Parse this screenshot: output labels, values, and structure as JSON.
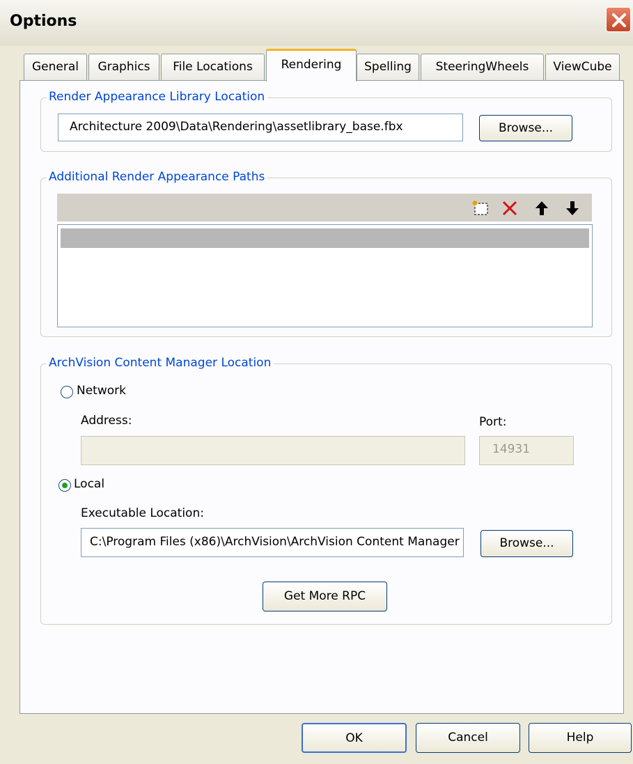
{
  "window": {
    "title": "Options"
  },
  "tabs": [
    {
      "label": "General"
    },
    {
      "label": "Graphics"
    },
    {
      "label": "File Locations"
    },
    {
      "label": "Rendering"
    },
    {
      "label": "Spelling"
    },
    {
      "label": "SteeringWheels"
    },
    {
      "label": "ViewCube"
    }
  ],
  "active_tab": "Rendering",
  "library": {
    "legend": "Render Appearance Library Location",
    "path": "Architecture 2009\\Data\\Rendering\\assetlibrary_base.fbx",
    "browse_label": "Browse..."
  },
  "additional_paths": {
    "legend": "Additional Render Appearance Paths",
    "toolbar_icons": [
      "new-path-icon",
      "delete-icon",
      "move-up-icon",
      "move-down-icon"
    ]
  },
  "archvision": {
    "legend": "ArchVision Content Manager Location",
    "network_label": "Network",
    "address_label": "Address:",
    "address_value": "",
    "port_label": "Port:",
    "port_value": "14931",
    "local_label": "Local",
    "selected": "Local",
    "exec_label": "Executable Location:",
    "exec_value": "C:\\Program Files (x86)\\ArchVision\\ArchVision Content Manager",
    "browse_label": "Browse...",
    "get_rpc_label": "Get More RPC"
  },
  "footer": {
    "ok_label": "OK",
    "cancel_label": "Cancel",
    "help_label": "Help"
  },
  "colors": {
    "legend_text": "#0046d5",
    "active_tab_accent": "#f2b32b",
    "close_button": "#c24526"
  }
}
